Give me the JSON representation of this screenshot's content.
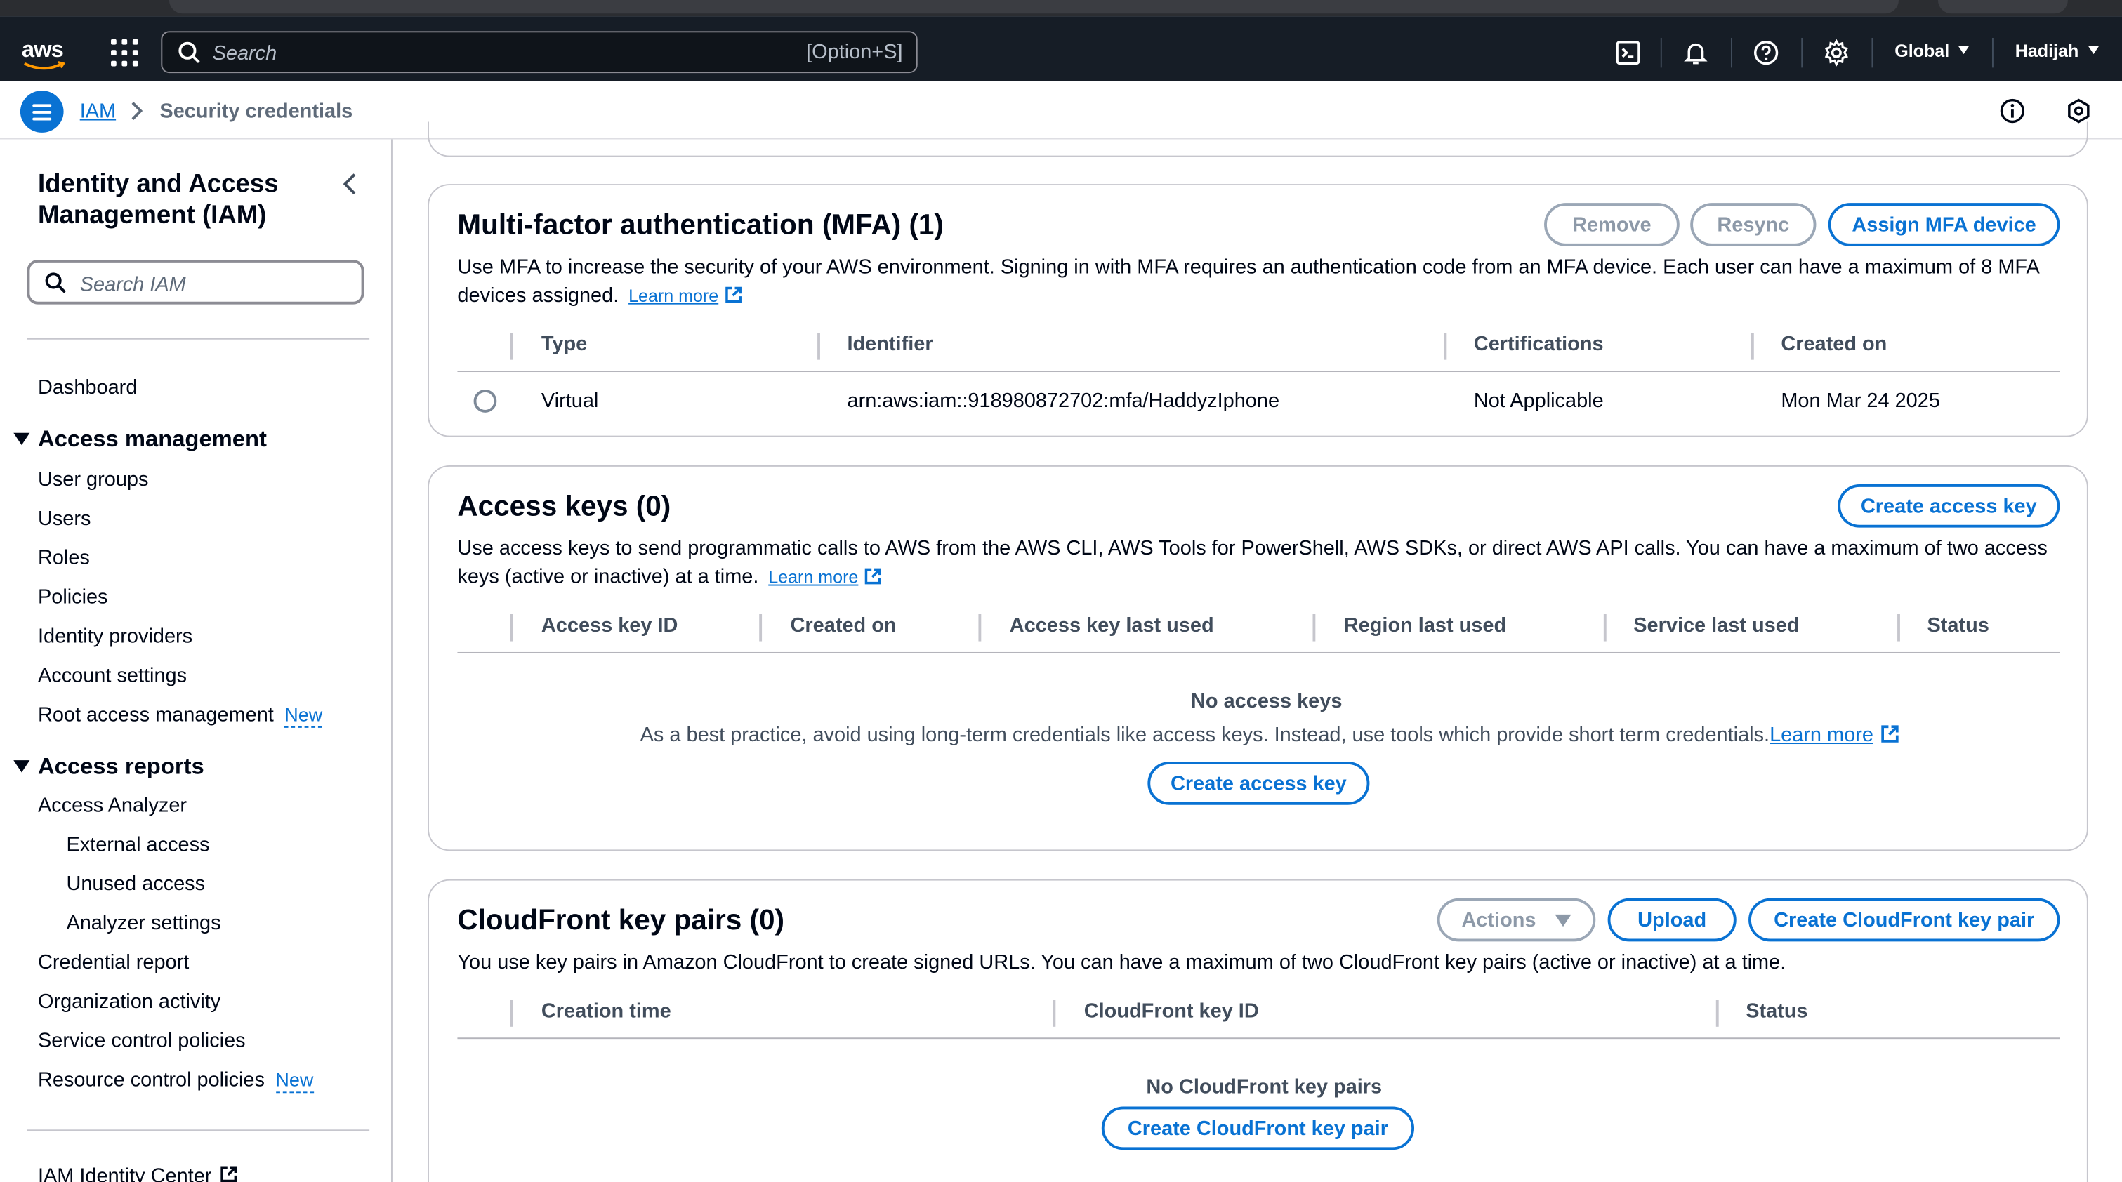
{
  "topnav": {
    "logo": "aws",
    "search_placeholder": "Search",
    "search_shortcut": "[Option+S]",
    "region": "Global",
    "user": "Hadijah",
    "icons": [
      "cloudshell-icon",
      "bell-icon",
      "help-icon",
      "settings-icon"
    ]
  },
  "breadcrumb": {
    "root": "IAM",
    "current": "Security credentials"
  },
  "sidebar": {
    "title": "Identity and Access Management (IAM)",
    "search_placeholder": "Search IAM",
    "dashboard": "Dashboard",
    "access_management": {
      "label": "Access management",
      "items": [
        "User groups",
        "Users",
        "Roles",
        "Policies",
        "Identity providers",
        "Account settings"
      ],
      "root_access": "Root access management",
      "root_access_badge": "New"
    },
    "access_reports": {
      "label": "Access reports",
      "analyzer": "Access Analyzer",
      "analyzer_items": [
        "External access",
        "Unused access",
        "Analyzer settings"
      ],
      "items": [
        "Credential report",
        "Organization activity",
        "Service control policies"
      ],
      "resource_policies": "Resource control policies",
      "resource_policies_badge": "New"
    },
    "identity_center": "IAM Identity Center"
  },
  "mfa": {
    "title": "Multi-factor authentication (MFA) (1)",
    "remove": "Remove",
    "resync": "Resync",
    "assign": "Assign MFA device",
    "desc": "Use MFA to increase the security of your AWS environment. Signing in with MFA requires an authentication code from an MFA device. Each user can have a maximum of 8 MFA devices assigned.",
    "learn_more": "Learn more",
    "columns": [
      "Type",
      "Identifier",
      "Certifications",
      "Created on"
    ],
    "rows": [
      {
        "type": "Virtual",
        "identifier": "arn:aws:iam::918980872702:mfa/HaddyzIphone",
        "certifications": "Not Applicable",
        "created_on": "Mon Mar 24 2025"
      }
    ]
  },
  "access_keys": {
    "title": "Access keys (0)",
    "create": "Create access key",
    "desc": "Use access keys to send programmatic calls to AWS from the AWS CLI, AWS Tools for PowerShell, AWS SDKs, or direct AWS API calls. You can have a maximum of two access keys (active or inactive) at a time.",
    "learn_more": "Learn more",
    "columns": [
      "Access key ID",
      "Created on",
      "Access key last used",
      "Region last used",
      "Service last used",
      "Status"
    ],
    "empty_title": "No access keys",
    "empty_desc": "As a best practice, avoid using long-term credentials like access keys. Instead, use tools which provide short term credentials.",
    "empty_learn_more": "Learn more",
    "empty_create": "Create access key"
  },
  "cloudfront": {
    "title": "CloudFront key pairs (0)",
    "actions": "Actions",
    "upload": "Upload",
    "create": "Create CloudFront key pair",
    "desc": "You use key pairs in Amazon CloudFront to create signed URLs. You can have a maximum of two CloudFront key pairs (active or inactive) at a time.",
    "columns": [
      "Creation time",
      "CloudFront key ID",
      "Status"
    ],
    "empty_title": "No CloudFront key pairs",
    "empty_create": "Create CloudFront key pair"
  },
  "colors": {
    "accent": "#0972d3",
    "nav_bg": "#161d26"
  }
}
